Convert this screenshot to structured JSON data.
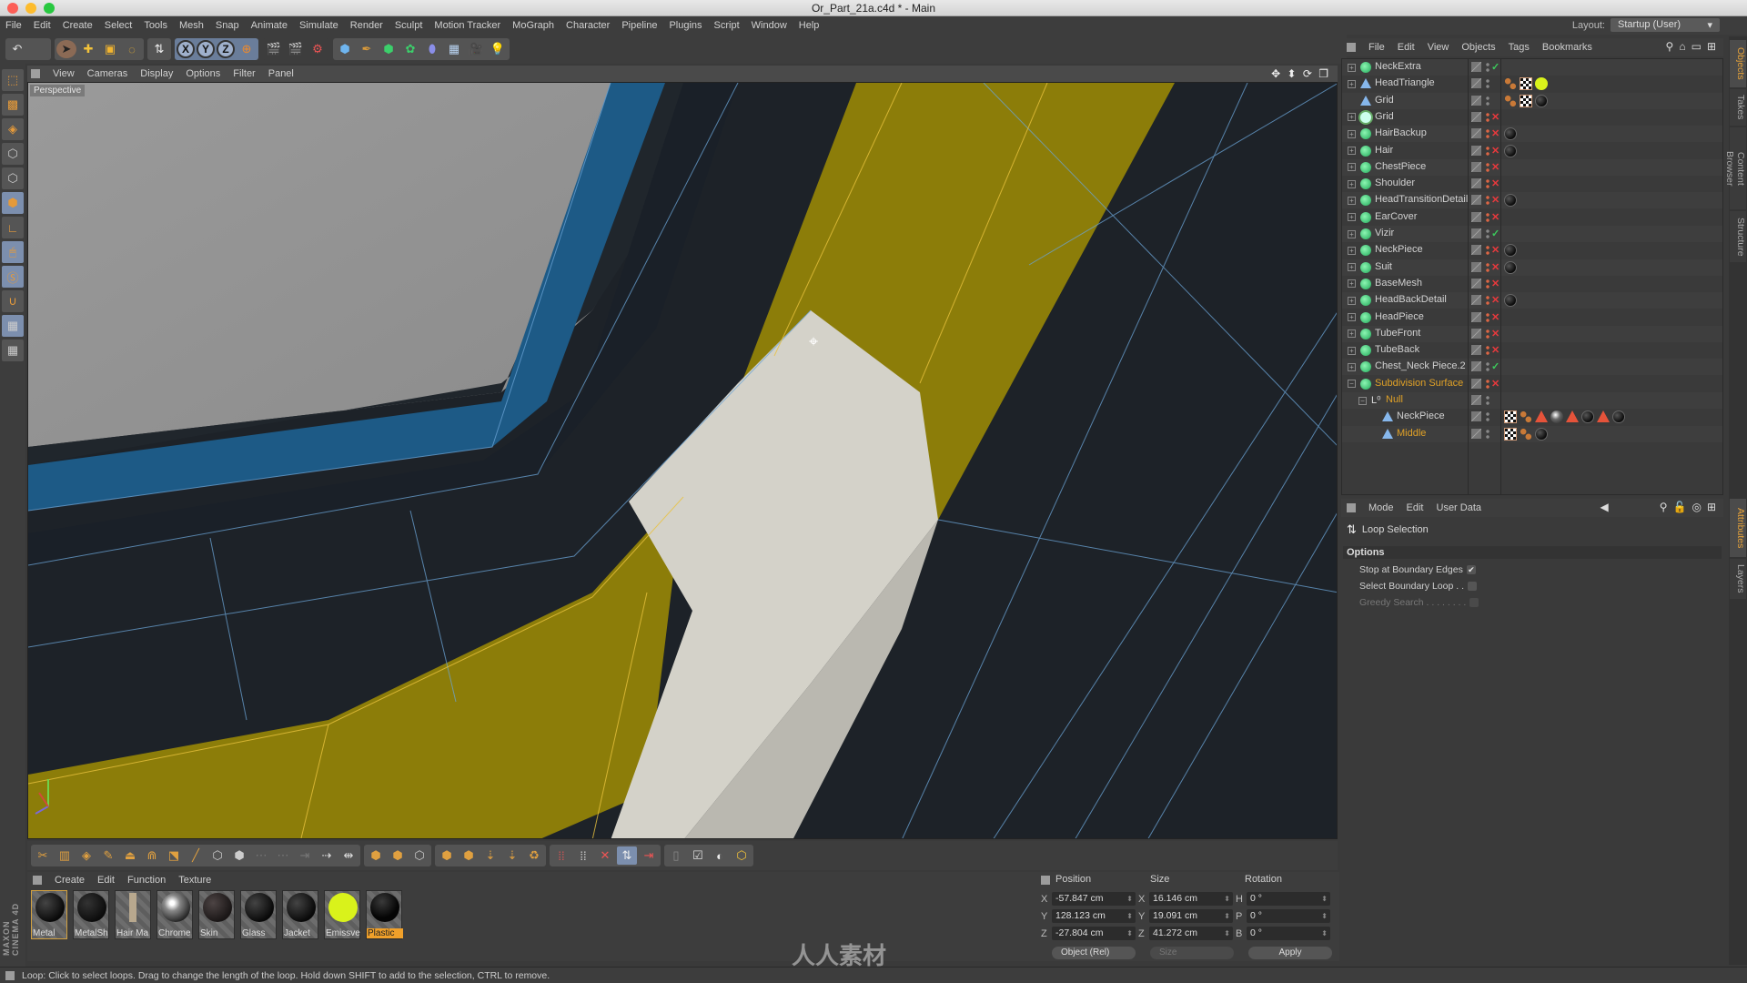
{
  "window": {
    "title": "Or_Part_21a.c4d * - Main"
  },
  "menubar": {
    "items": [
      "File",
      "Edit",
      "Create",
      "Select",
      "Tools",
      "Mesh",
      "Snap",
      "Animate",
      "Simulate",
      "Render",
      "Sculpt",
      "Motion Tracker",
      "MoGraph",
      "Character",
      "Pipeline",
      "Plugins",
      "Script",
      "Window",
      "Help"
    ],
    "layout_label": "Layout:",
    "layout_value": "Startup (User)"
  },
  "top_toolbar": {
    "undo_icon": "undo-icon",
    "mode_tools": [
      "select-icon",
      "move-icon",
      "scale-icon",
      "rotate-icon",
      "loop-select-icon"
    ],
    "axis_locks": [
      "X",
      "Y",
      "Z"
    ],
    "coord_system_icon": "world-coordinates-icon",
    "render_tools": [
      "render-view-icon",
      "render-picture-viewer-icon",
      "render-settings-icon"
    ],
    "create_tools": [
      "cube-icon",
      "pen-icon",
      "subdivision-icon",
      "cloner-icon",
      "deformer-icon",
      "floor-icon",
      "camera-icon",
      "light-icon"
    ]
  },
  "left_tools": [
    "make-editable-icon",
    "texture-mode-icon",
    "workplane-icon",
    "points-mode-icon",
    "edges-mode-icon",
    "polygons-mode-icon",
    "axis-icon",
    "tweak-icon",
    "solo-icon",
    "snap-icon",
    "lock-workplane-icon",
    "workplane-settings-icon"
  ],
  "viewport": {
    "menu": [
      "View",
      "Cameras",
      "Display",
      "Options",
      "Filter",
      "Panel"
    ],
    "camera_label": "Perspective",
    "nav_icons": "✥ ⬍ ⟳ ❐"
  },
  "material_manager": {
    "menu": [
      "Create",
      "Edit",
      "Function",
      "Texture"
    ],
    "materials": [
      {
        "name": "Metal",
        "kind": "dark",
        "selected_frame": true
      },
      {
        "name": "MetalSh",
        "kind": "dark"
      },
      {
        "name": "Hair Ma",
        "kind": "hair"
      },
      {
        "name": "Chrome",
        "kind": "chrome"
      },
      {
        "name": "Skin",
        "kind": "dark"
      },
      {
        "name": "Glass",
        "kind": "dark"
      },
      {
        "name": "Jacket",
        "kind": "dark"
      },
      {
        "name": "Emissve",
        "kind": "yellow"
      },
      {
        "name": "Plastic",
        "kind": "dark",
        "active": true
      }
    ]
  },
  "coordinates": {
    "headers": {
      "position": "Position",
      "size": "Size",
      "rotation": "Rotation"
    },
    "rows": [
      {
        "pos_axis": "X",
        "pos": "-57.847 cm",
        "size_axis": "X",
        "size": "16.146 cm",
        "rot_axis": "H",
        "rot": "0 °"
      },
      {
        "pos_axis": "Y",
        "pos": "128.123 cm",
        "size_axis": "Y",
        "size": "19.091 cm",
        "rot_axis": "P",
        "rot": "0 °"
      },
      {
        "pos_axis": "Z",
        "pos": "-27.804 cm",
        "size_axis": "Z",
        "size": "41.272 cm",
        "rot_axis": "B",
        "rot": "0 °"
      }
    ],
    "mode_dropdown": "Object (Rel)",
    "size_dropdown": "Size",
    "apply_label": "Apply"
  },
  "status_bar": {
    "text": "Loop: Click to select loops. Drag to change the length of the loop. Hold down SHIFT to add to the selection, CTRL to remove."
  },
  "object_manager": {
    "menu": [
      "File",
      "Edit",
      "View",
      "Objects",
      "Tags",
      "Bookmarks"
    ],
    "objects": [
      {
        "name": "NeckExtra",
        "icon": "poly",
        "expand": "+",
        "flag": "ok",
        "tags": []
      },
      {
        "name": "HeadTriangle",
        "icon": "tri",
        "expand": "+",
        "flag": "",
        "tags": [
          "uvw",
          "checker",
          "matY"
        ]
      },
      {
        "name": "Grid",
        "icon": "tri",
        "expand": "",
        "flag": "",
        "tags": [
          "uvw",
          "checker",
          "mat"
        ]
      },
      {
        "name": "Grid",
        "icon": "gen",
        "expand": "+",
        "flag": "x",
        "tags": []
      },
      {
        "name": "HairBackup",
        "icon": "poly",
        "expand": "+",
        "flag": "x",
        "tags": [
          "mat"
        ]
      },
      {
        "name": "Hair",
        "icon": "poly",
        "expand": "+",
        "flag": "x",
        "tags": [
          "mat"
        ]
      },
      {
        "name": "ChestPiece",
        "icon": "poly",
        "expand": "+",
        "flag": "x",
        "tags": []
      },
      {
        "name": "Shoulder",
        "icon": "poly",
        "expand": "+",
        "flag": "x",
        "tags": []
      },
      {
        "name": "HeadTransitionDetail",
        "icon": "poly",
        "expand": "+",
        "flag": "x",
        "tags": [
          "mat"
        ]
      },
      {
        "name": "EarCover",
        "icon": "poly",
        "expand": "+",
        "flag": "x",
        "tags": []
      },
      {
        "name": "Vizir",
        "icon": "poly",
        "expand": "+",
        "flag": "ok",
        "tags": []
      },
      {
        "name": "NeckPiece",
        "icon": "poly",
        "expand": "+",
        "flag": "x",
        "tags": [
          "mat"
        ]
      },
      {
        "name": "Suit",
        "icon": "poly",
        "expand": "+",
        "flag": "x",
        "tags": [
          "mat"
        ]
      },
      {
        "name": "BaseMesh",
        "icon": "poly",
        "expand": "+",
        "flag": "x",
        "tags": []
      },
      {
        "name": "HeadBackDetail",
        "icon": "poly",
        "expand": "+",
        "flag": "x",
        "tags": [
          "mat"
        ]
      },
      {
        "name": "HeadPiece",
        "icon": "poly",
        "expand": "+",
        "flag": "x",
        "tags": []
      },
      {
        "name": "TubeFront",
        "icon": "poly",
        "expand": "+",
        "flag": "x",
        "tags": []
      },
      {
        "name": "TubeBack",
        "icon": "poly",
        "expand": "+",
        "flag": "x",
        "tags": []
      },
      {
        "name": "Chest_Neck Piece.2",
        "icon": "poly",
        "expand": "+",
        "flag": "ok",
        "tags": []
      },
      {
        "name": "Subdivision Surface",
        "icon": "poly",
        "expand": "-",
        "flag": "x",
        "tags": [],
        "highlight": true
      },
      {
        "name": "Null",
        "icon": "null",
        "expand": "-",
        "flag": "",
        "tags": [],
        "highlight": true,
        "indent": 1
      },
      {
        "name": "NeckPiece",
        "icon": "tri",
        "expand": "",
        "flag": "",
        "tags": [
          "checker",
          "uvw",
          "warn",
          "matChrome",
          "warn",
          "mat",
          "warn",
          "mat"
        ],
        "indent": 2
      },
      {
        "name": "Middle",
        "icon": "tri",
        "expand": "",
        "flag": "",
        "tags": [
          "checker",
          "uvw",
          "mat"
        ],
        "highlight": true,
        "indent": 2
      }
    ]
  },
  "attribute_manager": {
    "menu": [
      "Mode",
      "Edit",
      "User Data"
    ],
    "tool_title": "Loop Selection",
    "section": "Options",
    "options": [
      {
        "label": "Stop at Boundary Edges",
        "checked": true,
        "enabled": true
      },
      {
        "label": "Select Boundary Loop . .",
        "checked": false,
        "enabled": true
      },
      {
        "label": "Greedy Search . . . . . . . .",
        "checked": false,
        "enabled": false
      }
    ]
  },
  "side_tabs": {
    "top": [
      "Objects",
      "Takes",
      "Content Browser",
      "Structure"
    ],
    "bottom": [
      "Attributes",
      "Layers"
    ]
  },
  "branding": {
    "vertical_logo": "MAXON CINEMA 4D",
    "watermark": "人人素材"
  },
  "colors": {
    "accent": "#e9a43a",
    "selection_yellow": "#8c7d09",
    "blue_poly": "#1d5a86",
    "highlight_poly": "#d4d2c9",
    "check_green": "#3cca5c",
    "cross_red": "#e8393d"
  }
}
